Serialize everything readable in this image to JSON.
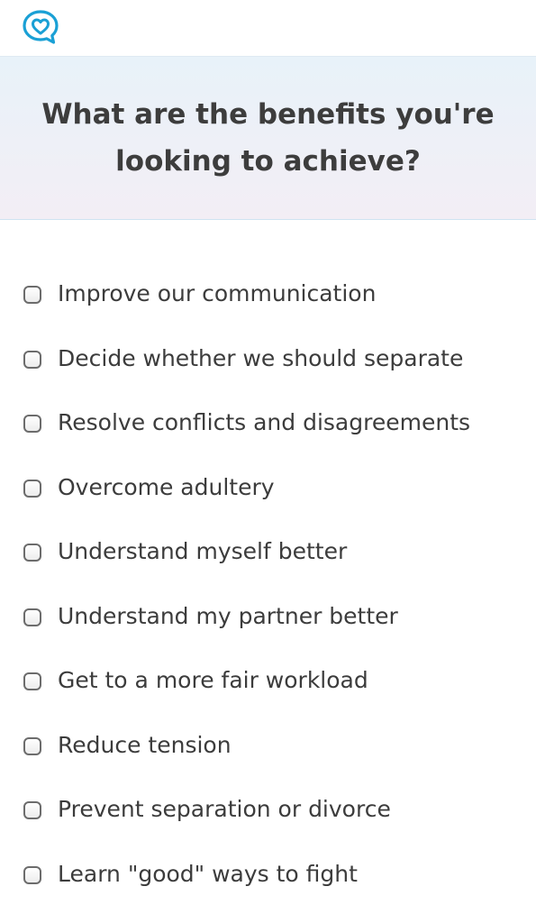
{
  "header": {
    "logo_icon": "heart-chat-bubble-icon",
    "accent_color": "#1aa0d5"
  },
  "question": {
    "title": "What are the benefits you're looking to achieve?"
  },
  "options": [
    {
      "label": "Improve our communication",
      "checked": false
    },
    {
      "label": "Decide whether we should separate",
      "checked": false
    },
    {
      "label": "Resolve conflicts and disagreements",
      "checked": false
    },
    {
      "label": "Overcome adultery",
      "checked": false
    },
    {
      "label": "Understand myself better",
      "checked": false
    },
    {
      "label": "Understand my partner better",
      "checked": false
    },
    {
      "label": "Get to a more fair workload",
      "checked": false
    },
    {
      "label": "Reduce tension",
      "checked": false
    },
    {
      "label": "Prevent separation or divorce",
      "checked": false
    },
    {
      "label": "Learn \"good\" ways to fight",
      "checked": false
    }
  ]
}
